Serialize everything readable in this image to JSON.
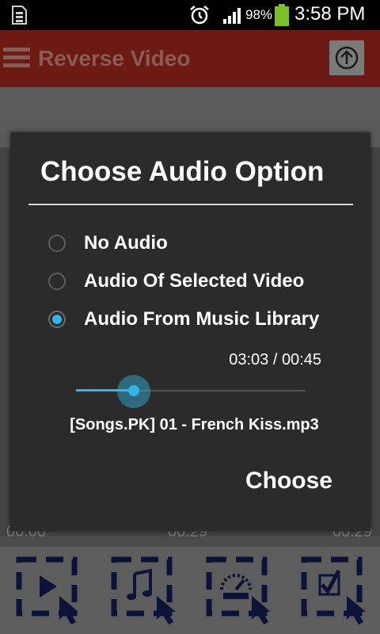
{
  "status_bar": {
    "battery_percent": "98%",
    "time": "3:58 PM",
    "icons": [
      "sd-card-icon",
      "alarm-icon",
      "signal-icon",
      "battery-icon"
    ]
  },
  "app_bar": {
    "title": "Reverse Video",
    "icons": [
      "menu-icon",
      "upload-icon"
    ]
  },
  "timeline": {
    "labels": [
      "00:00",
      "00:29",
      "00:29"
    ]
  },
  "toolbar": {
    "tools": [
      "play-video-icon",
      "music-note-icon",
      "speedometer-icon",
      "checkbox-icon"
    ]
  },
  "dialog": {
    "title": "Choose Audio Option",
    "options": [
      {
        "label": "No Audio",
        "selected": false
      },
      {
        "label": "Audio Of Selected Video",
        "selected": false
      },
      {
        "label": "Audio From Music Library",
        "selected": true
      }
    ],
    "time_readout": "03:03 / 00:45",
    "seek_progress": 0.25,
    "file_name": "[Songs.PK] 01 - French Kiss.mp3",
    "choose_label": "Choose"
  },
  "colors": {
    "accent": "#33b5e5",
    "app_bar": "#6e1a14",
    "dialog_bg": "#2b2b2b"
  }
}
